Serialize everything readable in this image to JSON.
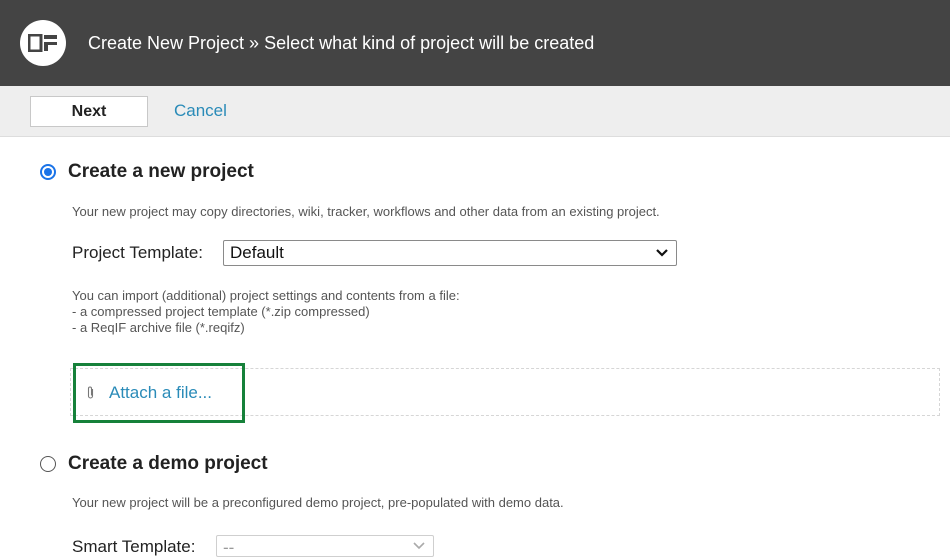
{
  "header": {
    "title": "Create New Project » Select what kind of project will be created",
    "logo_icon": "codebeamer-logo-icon"
  },
  "toolbar": {
    "next_label": "Next",
    "cancel_label": "Cancel"
  },
  "new_project": {
    "selected": true,
    "title": "Create a new project",
    "description": "Your new project may copy directories, wiki, tracker, workflows and other data from an existing project.",
    "template_label": "Project Template:",
    "template_value": "Default",
    "import_line1": "You can import (additional) project settings and contents from a file:",
    "import_line2": "- a compressed project template (*.zip compressed)",
    "import_line3": "- a ReqIF archive file (*.reqifz)",
    "attach_label": "Attach a file...",
    "attach_icon": "paperclip-icon"
  },
  "demo_project": {
    "selected": false,
    "title": "Create a demo project",
    "description": "Your new project will be a preconfigured demo project, pre-populated with demo data.",
    "template_label": "Smart Template:",
    "template_value": "--"
  },
  "colors": {
    "header_bg": "#444444",
    "link": "#2a8bb8",
    "radio_checked": "#1a73e8",
    "highlight": "#16813a"
  }
}
